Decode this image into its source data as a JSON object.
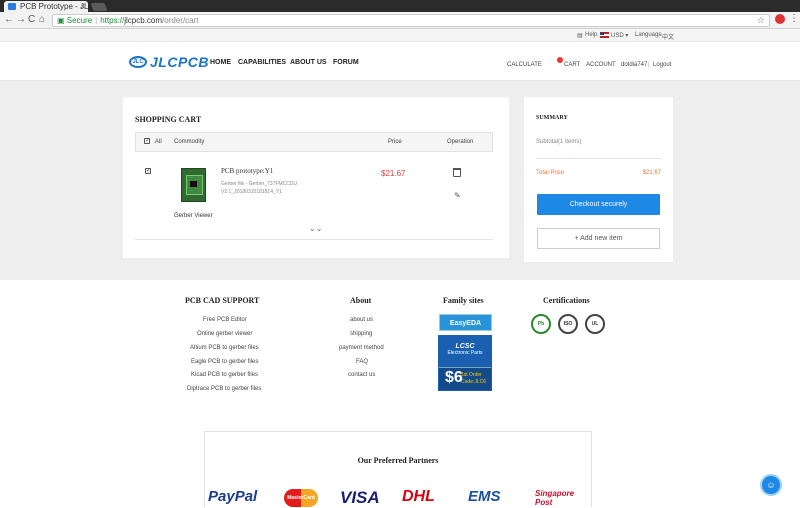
{
  "browser": {
    "tab_title": "PCB Prototype - JL",
    "tab_close": "×",
    "back": "←",
    "forward": "→",
    "reload": "C",
    "home": "⌂",
    "secure_label": "Secure",
    "url_scheme": "https://",
    "url_host": "jlcpcb.com",
    "url_path": "/order/cart",
    "star": "☆",
    "menu": "⋮"
  },
  "topbar": {
    "help": "Help",
    "currency": "USD ▾",
    "language": "Language",
    "language_value": "中文"
  },
  "header": {
    "logo_mark": "JLC",
    "logo_text": "JLCPCB",
    "nav": [
      "HOME",
      "CAPABILITIES",
      "ABOUT US",
      "FORUM"
    ],
    "calculate": "CALCULATE",
    "cart": "CART",
    "account": "ACCOUNT",
    "username": "dotdia747",
    "divider": "|",
    "logout": "Logout"
  },
  "cart": {
    "title": "SHOPPING CART",
    "header_all": "All",
    "header_commodity": "Commodity",
    "header_price": "Price",
    "header_operation": "Operation",
    "item": {
      "name": "PCB prototype:Y1",
      "file": "Gerber file - Gerber_737FMCCDU V2.1_20180310181814_Y1",
      "viewer": "Gerber Viewer",
      "price": "$21.67"
    },
    "expand_icon": "⌄⌄"
  },
  "summary": {
    "title": "SUMMARY",
    "subtotal": "Subtotal(1 items)",
    "total_label": "Total Price",
    "total_value": "$21.67",
    "checkout": "Checkout securely",
    "add_new": "+   Add new item"
  },
  "footer": {
    "pcb_support": {
      "title": "PCB CAD SUPPORT",
      "links": [
        "Free PCB Editor",
        "Online gerber viewer",
        "Altium PCB to gerber files",
        "Eagle PCB to gerber files",
        "Kicad PCB to gerber files",
        "Diptrace PCB to gerber files"
      ]
    },
    "about": {
      "title": "About",
      "links": [
        "about us",
        "shipping",
        "payment method",
        "FAQ",
        "contact us"
      ]
    },
    "family": {
      "title": "Family sites",
      "easyeda": "EasyEDA",
      "lcsc_name": "LCSC",
      "lcsc_sub": "Electronic Parts",
      "promo_amount": "$6",
      "promo_text": "1st Order",
      "promo_code": "Code:JLC6"
    },
    "certs": {
      "title": "Certifications",
      "items": [
        "Pb",
        "ISO",
        "UL"
      ]
    }
  },
  "partners": {
    "title": "Our Preferred Partners",
    "logos": [
      "PayPal",
      "MasterCard",
      "VISA",
      "DHL",
      "EMS",
      "Singapore Post"
    ]
  },
  "chat_icon": "☺",
  "colors": {
    "brand_blue": "#1e88e5",
    "price_red": "#e03a3a",
    "total_orange": "#e8772e"
  }
}
